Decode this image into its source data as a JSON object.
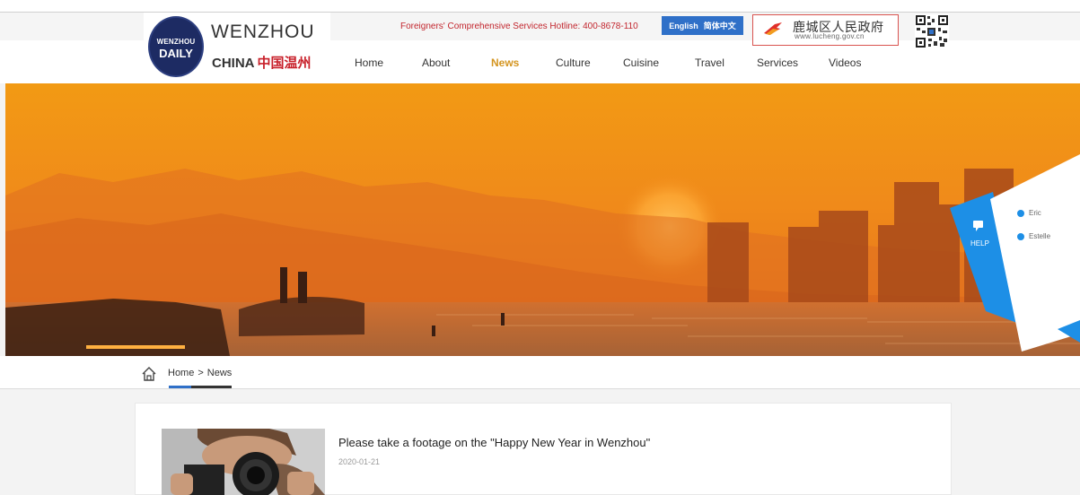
{
  "header": {
    "logo": {
      "line1": "WENZHOU",
      "line2": "DAILY"
    },
    "brand_en": "WENZHOU",
    "brand_china": "CHINA",
    "brand_cn": "中国温州",
    "hotline": "Foreigners' Comprehensive Services Hotline: 400-8678-110",
    "lang": {
      "english": "English",
      "chinese": "简体中文"
    },
    "gov": {
      "name": "鹿城区人民政府",
      "url": "www.lucheng.gov.cn"
    }
  },
  "nav": {
    "items": [
      "Home",
      "About",
      "News",
      "Culture",
      "Cuisine",
      "Travel",
      "Services",
      "Videos"
    ],
    "active": "News"
  },
  "help": {
    "label": "HELP",
    "agents": [
      "Eric",
      "Estelle"
    ]
  },
  "breadcrumb": {
    "home": "Home",
    "sep": ">",
    "current": "News"
  },
  "news": [
    {
      "title": "Please take a footage on the \"Happy New Year in Wenzhou\"",
      "date": "2020-01-21"
    }
  ],
  "colors": {
    "accent_blue": "#2f70c8",
    "hotline_red": "#c2262e",
    "nav_active": "#d49520",
    "help_blue": "#1d8fe6"
  }
}
